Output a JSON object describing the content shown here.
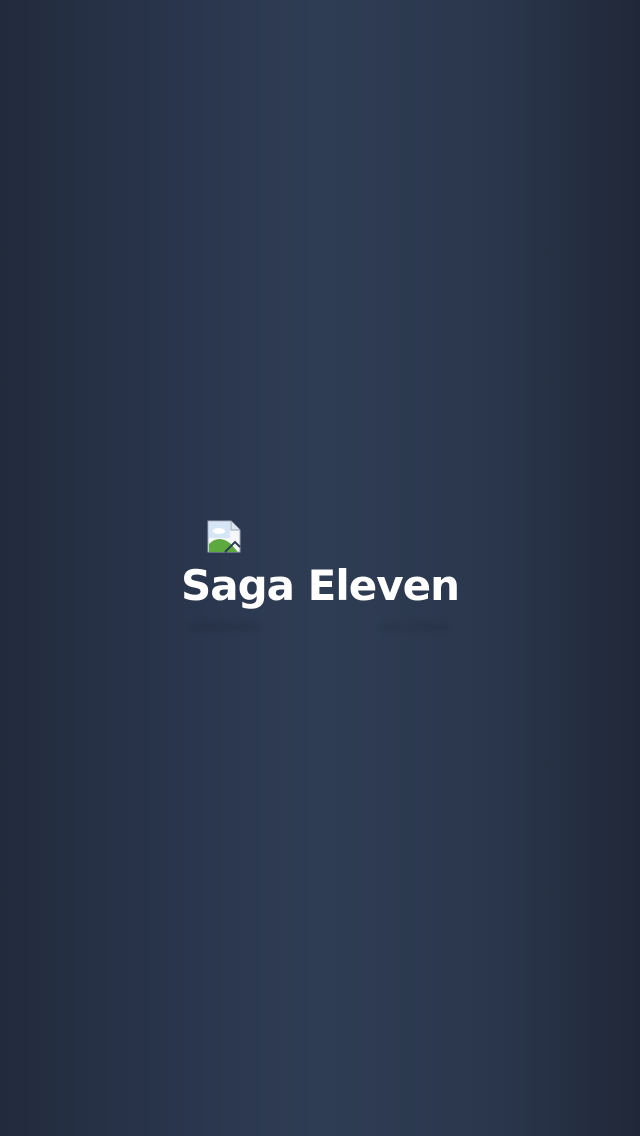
{
  "splash": {
    "title": "Saga Eleven",
    "logo": {
      "icon": "broken-image-icon"
    }
  },
  "colors": {
    "background_edge": "#222b3c",
    "background_center": "#2f3d54",
    "title_text": "#ffffff"
  }
}
